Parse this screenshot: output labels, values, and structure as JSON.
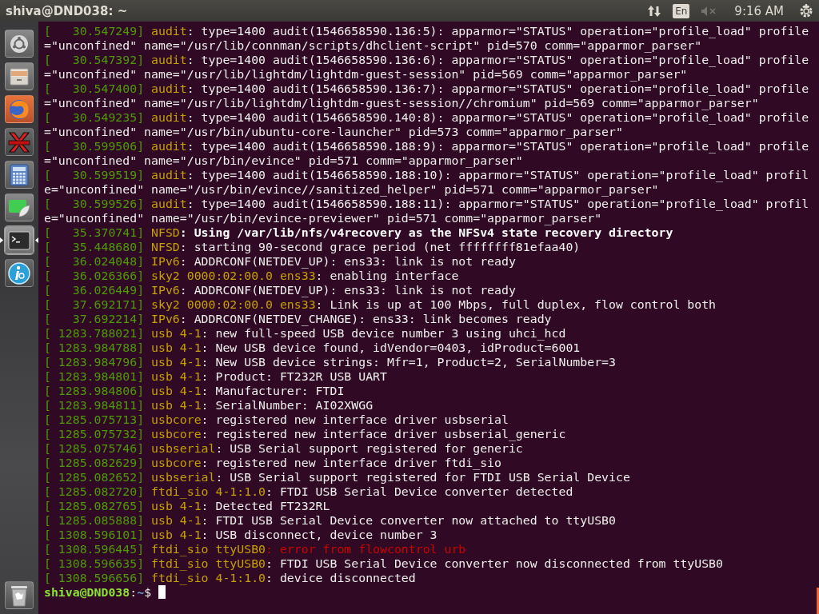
{
  "top_bar": {
    "title": "shiva@DND038: ~",
    "keyboard_layout": "En",
    "clock": "9:16 AM"
  },
  "launcher": {
    "items": [
      {
        "kind": "dash",
        "active": false
      },
      {
        "kind": "files",
        "active": false
      },
      {
        "kind": "browser",
        "active": false
      },
      {
        "kind": "redx",
        "active": false
      },
      {
        "kind": "calculator",
        "active": false
      },
      {
        "kind": "leaf",
        "active": false
      },
      {
        "kind": "terminal",
        "active": true
      },
      {
        "kind": "info",
        "active": false
      }
    ],
    "trash": {
      "kind": "trash"
    }
  },
  "terminal": {
    "lines": [
      {
        "timestamp": "[   30.547249]",
        "source": "audit",
        "message": ": type=1400 audit(1546658590.136:5): apparmor=\"STATUS\" operation=\"profile_load\" profile",
        "kind": "plain"
      },
      {
        "message": "=\"unconfined\" name=\"/usr/lib/connman/scripts/dhclient-script\" pid=570 comm=\"apparmor_parser\"",
        "kind": "plain"
      },
      {
        "timestamp": "[   30.547392]",
        "source": "audit",
        "message": ": type=1400 audit(1546658590.136:6): apparmor=\"STATUS\" operation=\"profile_load\" profile",
        "kind": "plain"
      },
      {
        "message": "=\"unconfined\" name=\"/usr/lib/lightdm/lightdm-guest-session\" pid=569 comm=\"apparmor_parser\"",
        "kind": "plain"
      },
      {
        "timestamp": "[   30.547400]",
        "source": "audit",
        "message": ": type=1400 audit(1546658590.136:7): apparmor=\"STATUS\" operation=\"profile_load\" profile",
        "kind": "plain"
      },
      {
        "message": "=\"unconfined\" name=\"/usr/lib/lightdm/lightdm-guest-session//chromium\" pid=569 comm=\"apparmor_parser\"",
        "kind": "plain"
      },
      {
        "timestamp": "[   30.549235]",
        "source": "audit",
        "message": ": type=1400 audit(1546658590.140:8): apparmor=\"STATUS\" operation=\"profile_load\" profile",
        "kind": "plain"
      },
      {
        "message": "=\"unconfined\" name=\"/usr/bin/ubuntu-core-launcher\" pid=573 comm=\"apparmor_parser\"",
        "kind": "plain"
      },
      {
        "timestamp": "[   30.599506]",
        "source": "audit",
        "message": ": type=1400 audit(1546658590.188:9): apparmor=\"STATUS\" operation=\"profile_load\" profile",
        "kind": "plain"
      },
      {
        "message": "=\"unconfined\" name=\"/usr/bin/evince\" pid=571 comm=\"apparmor_parser\"",
        "kind": "plain"
      },
      {
        "timestamp": "[   30.599519]",
        "source": "audit",
        "message": ": type=1400 audit(1546658590.188:10): apparmor=\"STATUS\" operation=\"profile_load\" profil",
        "kind": "plain"
      },
      {
        "message": "e=\"unconfined\" name=\"/usr/bin/evince//sanitized_helper\" pid=571 comm=\"apparmor_parser\"",
        "kind": "plain"
      },
      {
        "timestamp": "[   30.599526]",
        "source": "audit",
        "message": ": type=1400 audit(1546658590.188:11): apparmor=\"STATUS\" operation=\"profile_load\" profil",
        "kind": "plain"
      },
      {
        "message": "e=\"unconfined\" name=\"/usr/bin/evince-previewer\" pid=571 comm=\"apparmor_parser\"",
        "kind": "plain"
      },
      {
        "timestamp": "[   35.370741]",
        "source": "NFSD",
        "message": ": Using /var/lib/nfs/v4recovery as the NFSv4 state recovery directory",
        "kind": "bold"
      },
      {
        "timestamp": "[   35.448680]",
        "source": "NFSD",
        "message": ": starting 90-second grace period (net ffffffff81efaa40)",
        "kind": "plain"
      },
      {
        "timestamp": "[   36.024048]",
        "source": "IPv6",
        "message": ": ADDRCONF(NETDEV_UP): ens33: link is not ready",
        "kind": "plain"
      },
      {
        "timestamp": "[   36.026366]",
        "source": "sky2 0000:02:00.0 ens33",
        "message": ": enabling interface",
        "kind": "plain"
      },
      {
        "timestamp": "[   36.026449]",
        "source": "IPv6",
        "message": ": ADDRCONF(NETDEV_UP): ens33: link is not ready",
        "kind": "plain"
      },
      {
        "timestamp": "[   37.692171]",
        "source": "sky2 0000:02:00.0 ens33",
        "message": ": Link is up at 100 Mbps, full duplex, flow control both",
        "kind": "plain"
      },
      {
        "timestamp": "[   37.692214]",
        "source": "IPv6",
        "message": ": ADDRCONF(NETDEV_CHANGE): ens33: link becomes ready",
        "kind": "plain"
      },
      {
        "timestamp": "[ 1283.788021]",
        "source": "usb 4-1",
        "message": ": new full-speed USB device number 3 using uhci_hcd",
        "kind": "plain"
      },
      {
        "timestamp": "[ 1283.984788]",
        "source": "usb 4-1",
        "message": ": New USB device found, idVendor=0403, idProduct=6001",
        "kind": "plain"
      },
      {
        "timestamp": "[ 1283.984796]",
        "source": "usb 4-1",
        "message": ": New USB device strings: Mfr=1, Product=2, SerialNumber=3",
        "kind": "plain"
      },
      {
        "timestamp": "[ 1283.984801]",
        "source": "usb 4-1",
        "message": ": Product: FT232R USB UART",
        "kind": "plain"
      },
      {
        "timestamp": "[ 1283.984806]",
        "source": "usb 4-1",
        "message": ": Manufacturer: FTDI",
        "kind": "plain"
      },
      {
        "timestamp": "[ 1283.984811]",
        "source": "usb 4-1",
        "message": ": SerialNumber: AI02XWGG",
        "kind": "plain"
      },
      {
        "timestamp": "[ 1285.075713]",
        "source": "usbcore",
        "message": ": registered new interface driver usbserial",
        "kind": "plain"
      },
      {
        "timestamp": "[ 1285.075732]",
        "source": "usbcore",
        "message": ": registered new interface driver usbserial_generic",
        "kind": "plain"
      },
      {
        "timestamp": "[ 1285.075746]",
        "source": "usbserial",
        "message": ": USB Serial support registered for generic",
        "kind": "plain"
      },
      {
        "timestamp": "[ 1285.082629]",
        "source": "usbcore",
        "message": ": registered new interface driver ftdi_sio",
        "kind": "plain"
      },
      {
        "timestamp": "[ 1285.082652]",
        "source": "usbserial",
        "message": ": USB Serial support registered for FTDI USB Serial Device",
        "kind": "plain"
      },
      {
        "timestamp": "[ 1285.082720]",
        "source": "ftdi_sio 4-1:1.0",
        "message": ": FTDI USB Serial Device converter detected",
        "kind": "plain"
      },
      {
        "timestamp": "[ 1285.082765]",
        "source": "usb 4-1",
        "message": ": Detected FT232RL",
        "kind": "plain"
      },
      {
        "timestamp": "[ 1285.085888]",
        "source": "usb 4-1",
        "message": ": FTDI USB Serial Device converter now attached to ttyUSB0",
        "kind": "plain"
      },
      {
        "timestamp": "[ 1308.596101]",
        "source": "usb 4-1",
        "message": ": USB disconnect, device number 3",
        "kind": "plain"
      },
      {
        "timestamp": "[ 1308.596445]",
        "source": "ftdi_sio ttyUSB0",
        "message": ": error from flowcontrol urb",
        "kind": "error"
      },
      {
        "timestamp": "[ 1308.596635]",
        "source": "ftdi_sio ttyUSB0",
        "message": ": FTDI USB Serial Device converter now disconnected from ttyUSB0",
        "kind": "plain"
      },
      {
        "timestamp": "[ 1308.596656]",
        "source": "ftdi_sio 4-1:1.0",
        "message": ": device disconnected",
        "kind": "plain"
      }
    ],
    "prompt": {
      "user_host": "shiva@DND038",
      "separator": ":",
      "path": "~",
      "symbol": "$"
    }
  }
}
